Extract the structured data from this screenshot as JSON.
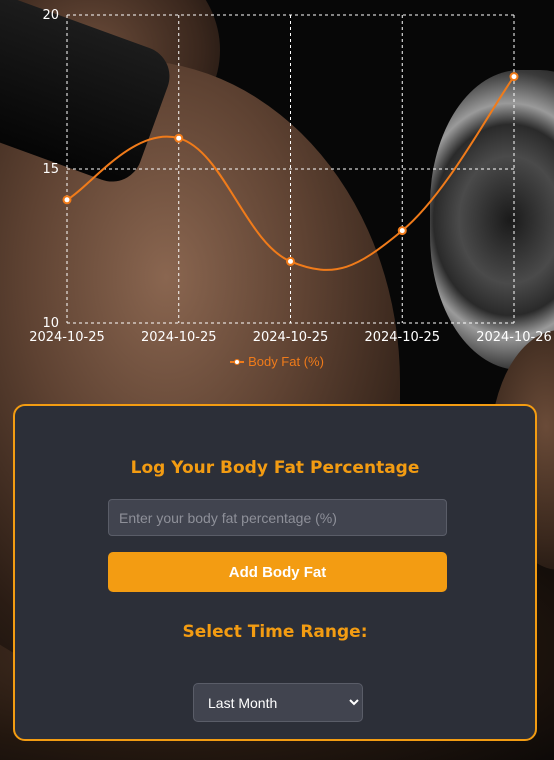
{
  "colors": {
    "accent": "#f39c12",
    "line": "#f07b1a",
    "panel_bg": "#2c2f38",
    "input_bg": "#41444f",
    "grid": "#ffffff"
  },
  "chart_data": {
    "type": "line",
    "x": [
      "2024-10-25",
      "2024-10-25",
      "2024-10-25",
      "2024-10-25",
      "2024-10-26"
    ],
    "series": [
      {
        "name": "Body Fat (%)",
        "values": [
          14.0,
          16.0,
          12.0,
          13.0,
          18.0
        ]
      }
    ],
    "ylim": [
      10,
      20
    ],
    "yticks": [
      10,
      15,
      20
    ],
    "grid": true,
    "legend": "bottom-center",
    "curve": "smooth"
  },
  "form": {
    "title": "Log Your Body Fat Percentage",
    "input_placeholder": "Enter your body fat percentage (%)",
    "input_value": "",
    "add_button": "Add Body Fat",
    "range_title": "Select Time Range:",
    "range_selected": "Last Month"
  }
}
